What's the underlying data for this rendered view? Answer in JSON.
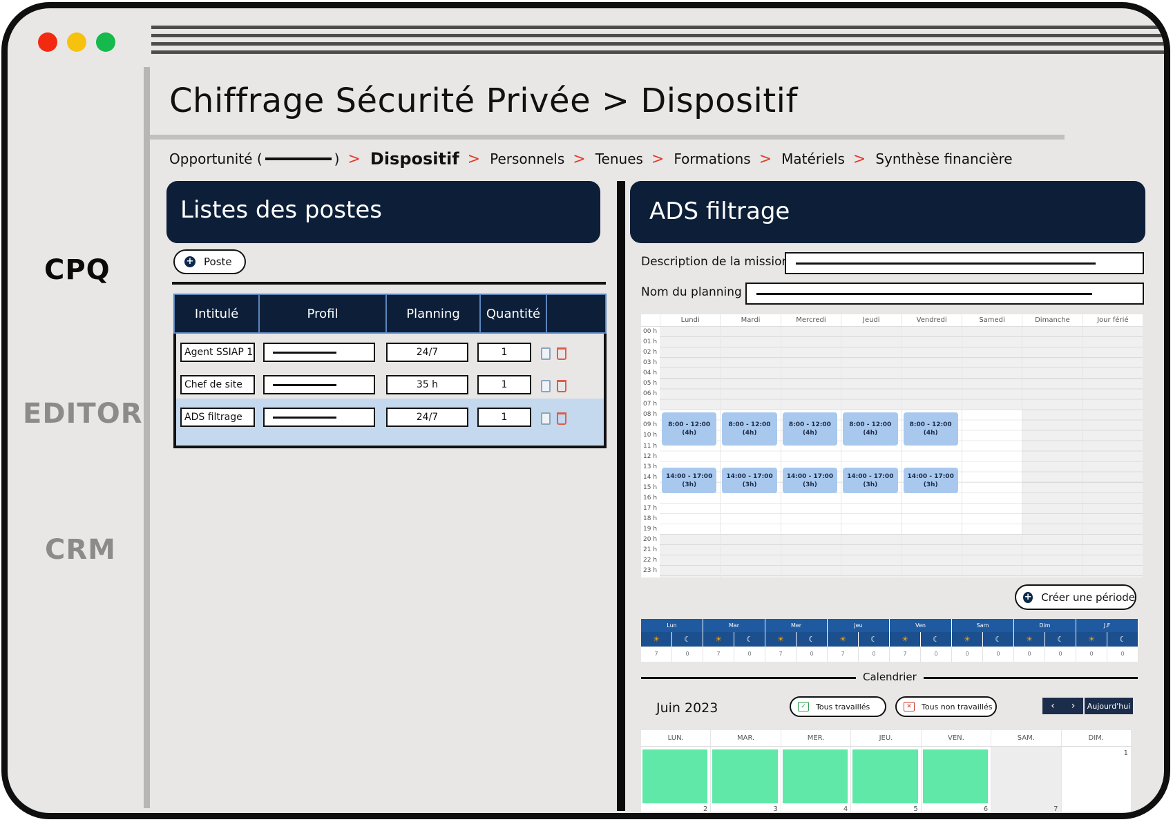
{
  "window": {
    "controls": [
      "close",
      "minimize",
      "maximize"
    ]
  },
  "sidebar": {
    "items": [
      {
        "label": "CPQ",
        "active": true
      },
      {
        "label": "EDITOR",
        "active": false
      },
      {
        "label": "CRM",
        "active": false
      }
    ]
  },
  "page": {
    "title": "Chiffrage Sécurité Privée > Dispositif"
  },
  "breadcrumb": {
    "items": [
      {
        "label_prefix": "Opportunité (",
        "label_suffix": ")"
      },
      {
        "label": "Dispositif"
      },
      {
        "label": "Personnels"
      },
      {
        "label": "Tenues"
      },
      {
        "label": "Formations"
      },
      {
        "label": "Matériels"
      },
      {
        "label": "Synthèse financière"
      }
    ],
    "separator": ">"
  },
  "left_panel": {
    "title": "Listes des postes",
    "add_button": "Poste",
    "table": {
      "headers": [
        "Intitulé",
        "Profil",
        "Planning",
        "Quantité",
        ""
      ],
      "rows": [
        {
          "intitule": "Agent SSIAP 1",
          "planning": "24/7",
          "quantite": "1",
          "selected": false
        },
        {
          "intitule": "Chef de site",
          "planning": "35 h",
          "quantite": "1",
          "selected": false
        },
        {
          "intitule": "ADS filtrage",
          "planning": "24/7",
          "quantite": "1",
          "selected": true
        }
      ]
    }
  },
  "right_panel": {
    "title": "ADS filtrage",
    "description_label": "Description de la mission",
    "planning_name_label": "Nom du planning",
    "week_calendar": {
      "days": [
        "Lundi",
        "Mardi",
        "Mercredi",
        "Jeudi",
        "Vendredi",
        "Samedi",
        "Dimanche",
        "Jour férié"
      ],
      "hours": [
        "00 h",
        "01 h",
        "02 h",
        "03 h",
        "04 h",
        "05 h",
        "06 h",
        "07 h",
        "08 h",
        "09 h",
        "10 h",
        "11 h",
        "12 h",
        "13 h",
        "14 h",
        "15 h",
        "16 h",
        "17 h",
        "18 h",
        "19 h",
        "20 h",
        "21 h",
        "22 h",
        "23 h"
      ],
      "events": [
        {
          "day": 0,
          "label": "8:00 - 12:00\n(4h)"
        },
        {
          "day": 1,
          "label": "8:00 - 12:00\n(4h)"
        },
        {
          "day": 2,
          "label": "8:00 - 12:00\n(4h)"
        },
        {
          "day": 3,
          "label": "8:00 - 12:00\n(4h)"
        },
        {
          "day": 4,
          "label": "8:00 - 12:00\n(4h)"
        },
        {
          "day": 0,
          "label": "14:00 - 17:00\n(3h)"
        },
        {
          "day": 1,
          "label": "14:00 - 17:00\n(3h)"
        },
        {
          "day": 2,
          "label": "14:00 - 17:00\n(3h)"
        },
        {
          "day": 3,
          "label": "14:00 - 17:00\n(3h)"
        },
        {
          "day": 4,
          "label": "14:00 - 17:00\n(3h)"
        }
      ]
    },
    "create_period_button": "Créer une période",
    "summary": {
      "days": [
        "Lun",
        "Mar",
        "Mer",
        "Jeu",
        "Ven",
        "Sam",
        "Dim",
        "J.F"
      ],
      "values": [
        "7",
        "0",
        "7",
        "0",
        "7",
        "0",
        "7",
        "0",
        "7",
        "0",
        "0",
        "0",
        "0",
        "0",
        "0",
        "0"
      ]
    },
    "calendar_section_label": "Calendrier",
    "month": {
      "label": "Juin 2023",
      "all_worked": "Tous travaillés",
      "all_not_worked": "Tous non travaillés",
      "prev": "‹",
      "next": "›",
      "today": "Aujourd'hui",
      "weekdays": [
        "LUN.",
        "MAR.",
        "MER.",
        "JEU.",
        "VEN.",
        "SAM.",
        "DIM."
      ],
      "day_numbers": [
        "2",
        "3",
        "4",
        "5",
        "6",
        "7",
        "1"
      ]
    }
  }
}
